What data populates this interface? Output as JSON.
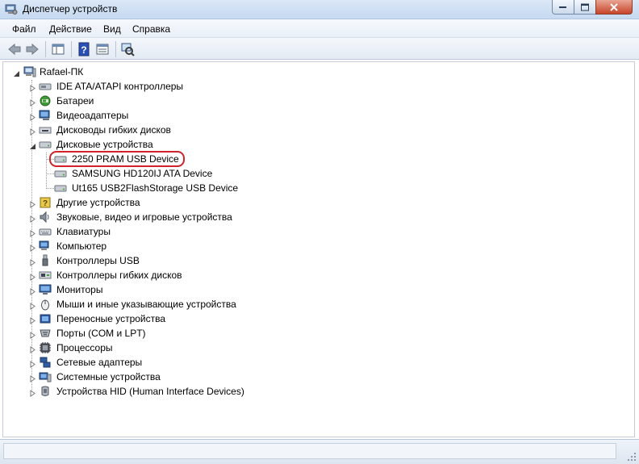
{
  "window": {
    "title": "Диспетчер устройств"
  },
  "menu": {
    "items": [
      "Файл",
      "Действие",
      "Вид",
      "Справка"
    ]
  },
  "toolbar": {
    "buttons": [
      "back-icon",
      "forward-icon",
      "console-tree-icon",
      "help-icon",
      "properties-icon",
      "scan-hardware-icon"
    ]
  },
  "tree": {
    "root": "Rafael-ПК",
    "categories": [
      {
        "label": "IDE ATA/ATAPI контроллеры",
        "icon": "ide-controller-icon"
      },
      {
        "label": "Батареи",
        "icon": "battery-icon"
      },
      {
        "label": "Видеоадаптеры",
        "icon": "display-adapter-icon"
      },
      {
        "label": "Дисководы гибких дисков",
        "icon": "floppy-drive-icon"
      },
      {
        "label": "Дисковые устройства",
        "icon": "disk-drive-icon",
        "expanded": true,
        "children": [
          {
            "label": "2250 PRAM USB Device",
            "highlighted": true
          },
          {
            "label": "SAMSUNG HD120IJ ATA Device"
          },
          {
            "label": "Ut165 USB2FlashStorage USB Device"
          }
        ]
      },
      {
        "label": "Другие устройства",
        "icon": "other-devices-icon"
      },
      {
        "label": "Звуковые, видео и игровые устройства",
        "icon": "sound-icon"
      },
      {
        "label": "Клавиатуры",
        "icon": "keyboard-icon"
      },
      {
        "label": "Компьютер",
        "icon": "computer-icon"
      },
      {
        "label": "Контроллеры USB",
        "icon": "usb-icon"
      },
      {
        "label": "Контроллеры гибких дисков",
        "icon": "floppy-controller-icon"
      },
      {
        "label": "Мониторы",
        "icon": "monitor-icon"
      },
      {
        "label": "Мыши и иные указывающие устройства",
        "icon": "mouse-icon"
      },
      {
        "label": "Переносные устройства",
        "icon": "portable-device-icon"
      },
      {
        "label": "Порты (COM и LPT)",
        "icon": "port-icon"
      },
      {
        "label": "Процессоры",
        "icon": "processor-icon"
      },
      {
        "label": "Сетевые адаптеры",
        "icon": "network-adapter-icon"
      },
      {
        "label": "Системные устройства",
        "icon": "system-device-icon"
      },
      {
        "label": "Устройства HID (Human Interface Devices)",
        "icon": "hid-icon"
      }
    ]
  },
  "colors": {
    "highlight_ring": "#d1232a",
    "titlebar": "#c6d9f0"
  }
}
